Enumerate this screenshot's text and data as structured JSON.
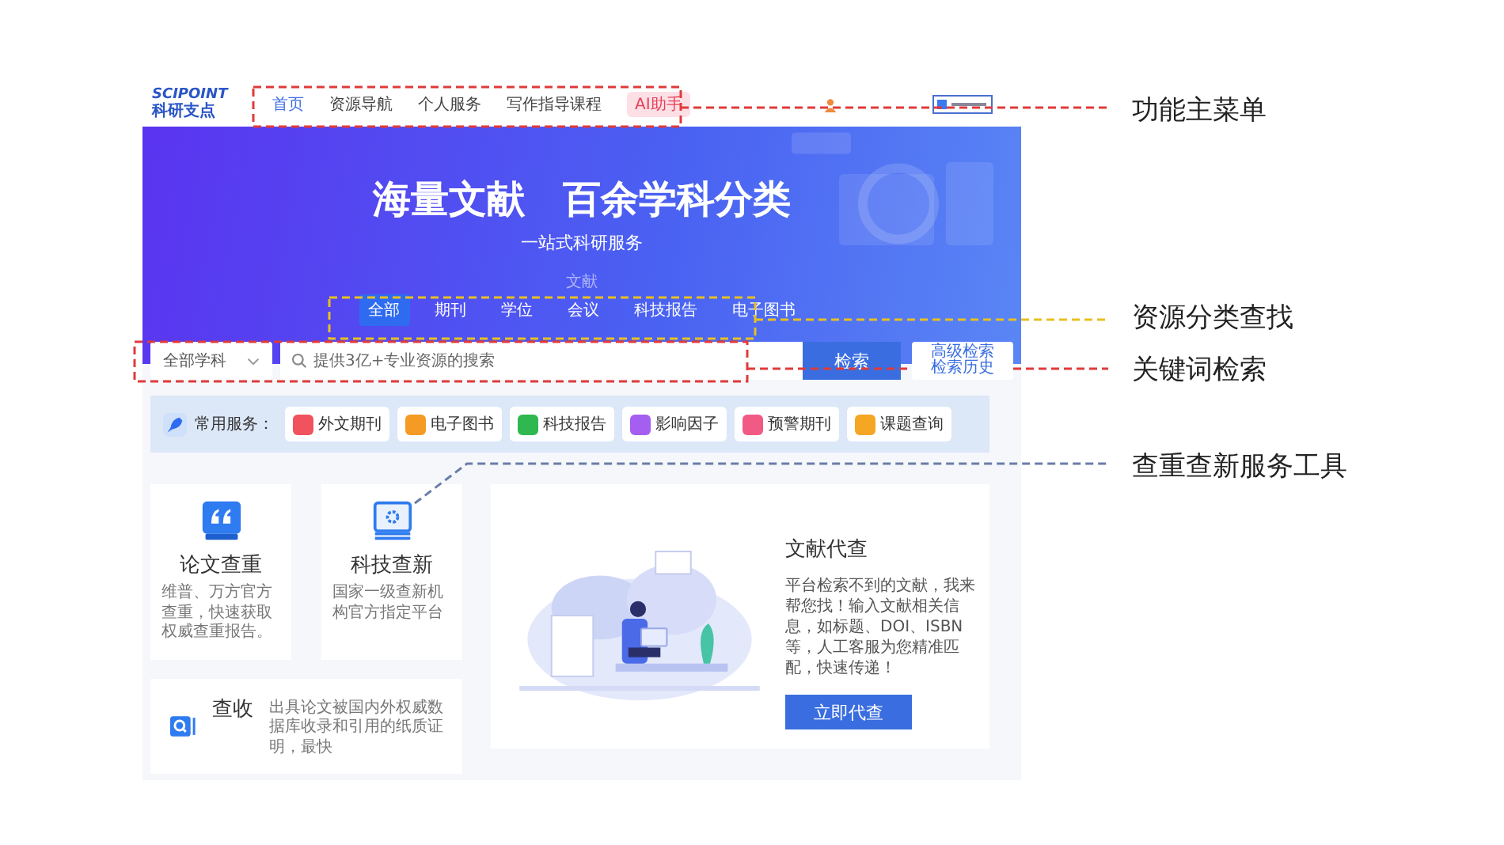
{
  "header": {
    "logo_wordmark": "SCIPOINT",
    "logo_title": "科研支点",
    "nav": [
      {
        "label": "首页",
        "selected": true,
        "kind": "link"
      },
      {
        "label": "资源导航",
        "selected": false,
        "kind": "link"
      },
      {
        "label": "个人服务",
        "selected": false,
        "kind": "link"
      },
      {
        "label": "写作指导课程",
        "selected": false,
        "kind": "link"
      },
      {
        "label": "AI助手",
        "selected": false,
        "kind": "badge"
      }
    ]
  },
  "hero": {
    "title": "海量文献　百余学科分类",
    "subtitle": "一站式科研服务",
    "category_caption": "文献",
    "tabs": [
      {
        "label": "全部",
        "selected": true
      },
      {
        "label": "期刊",
        "selected": false
      },
      {
        "label": "学位",
        "selected": false
      },
      {
        "label": "会议",
        "selected": false
      },
      {
        "label": "科技报告",
        "selected": false
      },
      {
        "label": "电子图书",
        "selected": false
      }
    ]
  },
  "search": {
    "subject_select": "全部学科",
    "placeholder": "提供3亿+专业资源的搜索",
    "button": "检索",
    "advanced": [
      "高级检索",
      "检索历史"
    ]
  },
  "services": {
    "label": "常用服务：",
    "items": [
      {
        "label": "外文期刊",
        "color": "#f0525e"
      },
      {
        "label": "电子图书",
        "color": "#f59a23"
      },
      {
        "label": "科技报告",
        "color": "#2fb84f"
      },
      {
        "label": "影响因子",
        "color": "#a45ef0"
      },
      {
        "label": "预警期刊",
        "color": "#f25a86"
      },
      {
        "label": "课题查询",
        "color": "#f5a623"
      }
    ]
  },
  "tools": [
    {
      "kind": "quote",
      "title": "论文查重",
      "description": "维普、万方官方查重，快速获取权威查重报告。"
    },
    {
      "kind": "gear",
      "title": "科技查新",
      "description": "国家一级查新机构官方指定平台"
    },
    {
      "kind": "search",
      "title": "查收",
      "description": "出具论文被国内外权威数据库收录和引用的纸质证明，最快"
    }
  ],
  "proxy_card": {
    "title": "文献代查",
    "description": "平台检索不到的文献，我来帮您找！输入文献相关信息，如标题、DOI、ISBN等，人工客服为您精准匹配，快速传递！",
    "button": "立即代查"
  },
  "annotations": [
    {
      "label": "功能主菜单",
      "color": "#e03a3a"
    },
    {
      "label": "资源分类查找",
      "color": "#e8c020"
    },
    {
      "label": "关键词检索",
      "color": "#e03a3a"
    },
    {
      "label": "查重查新服务工具",
      "color": "#6a7ea8"
    }
  ]
}
